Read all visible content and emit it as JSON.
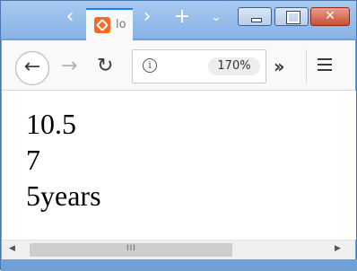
{
  "tab": {
    "title": "lo",
    "favicon": "xampp-icon"
  },
  "tabstrip": {
    "scroll_left_icon": "chevron-left-icon",
    "scroll_right_icon": "chevron-right-icon",
    "new_tab_icon": "plus-icon",
    "list_tabs_icon": "chevron-down-icon"
  },
  "window_controls": [
    "minimize",
    "maximize",
    "close"
  ],
  "navbar": {
    "back_icon": "arrow-left-icon",
    "forward_icon": "arrow-right-icon",
    "reload_icon": "reload-icon",
    "info_icon": "info-icon",
    "zoom_level": "170%",
    "overflow_icon": "double-chevron-right-icon",
    "menu_icon": "hamburger-menu-icon"
  },
  "content": {
    "lines": [
      "10.5",
      "7",
      "5years"
    ]
  },
  "scrollbar": {
    "left_arrow": "◀",
    "right_arrow": "▶",
    "grip": "III"
  },
  "colors": {
    "accent": "#0a84ff",
    "favicon": "#f26b29",
    "titlebar": "#88b2e6",
    "close_button": "#c94c34"
  }
}
